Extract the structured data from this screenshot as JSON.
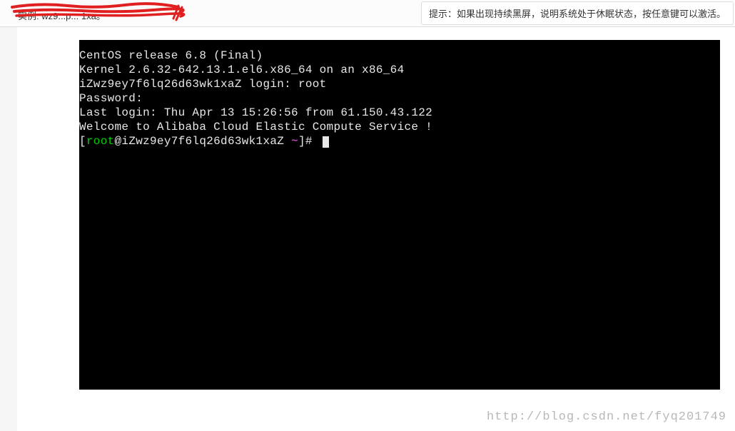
{
  "header": {
    "redacted_text": "实例: wz9...p... 1xa。",
    "hint_text": "提示：如果出现持续黑屏，说明系统处于休眠状态，按任意键可以激活。"
  },
  "terminal": {
    "line1": "CentOS release 6.8 (Final)",
    "line2": "Kernel 2.6.32-642.13.1.el6.x86_64 on an x86_64",
    "line3": "",
    "line4": "iZwz9ey7f6lq26d63wk1xaZ login: root",
    "line5": "Password:",
    "line6": "Last login: Thu Apr 13 15:26:56 from 61.150.43.122",
    "line7": "",
    "line8": "Welcome to Alibaba Cloud Elastic Compute Service !",
    "line9": "",
    "prompt_bracket_open": "[",
    "prompt_user": "root",
    "prompt_at_host": "@iZwz9ey7f6lq26d63wk1xaZ ",
    "prompt_tilde": "~",
    "prompt_end": "]# "
  },
  "watermark": "http://blog.csdn.net/fyq201749"
}
